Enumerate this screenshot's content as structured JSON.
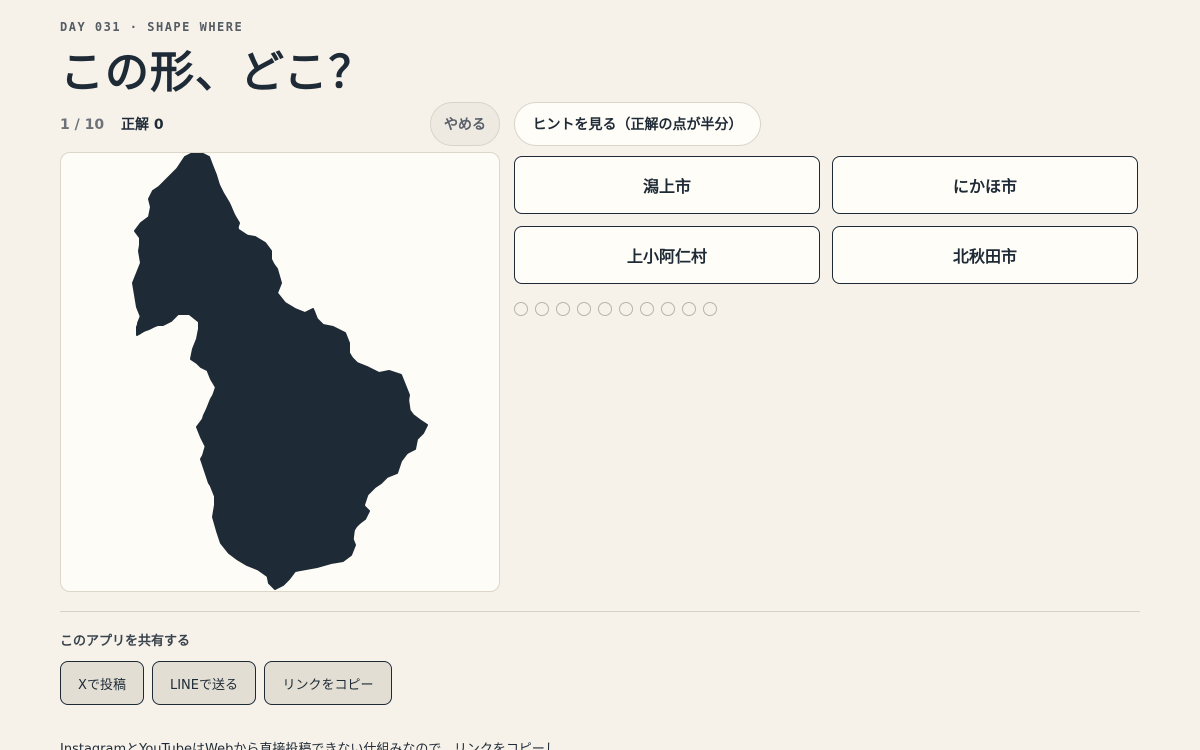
{
  "header": {
    "eyebrow": "DAY 031 · SHAPE WHERE",
    "title": "この形、どこ？"
  },
  "status": {
    "progress": "1 / 10",
    "score": "正解 0"
  },
  "controls": {
    "quit_label": "やめる",
    "hint_label": "ヒントを見る（正解の点が半分）"
  },
  "choices": [
    {
      "label": "潟上市"
    },
    {
      "label": "にかほ市"
    },
    {
      "label": "上小阿仁村"
    },
    {
      "label": "北秋田市"
    }
  ],
  "progress_dots": {
    "total": 10,
    "answered": 0
  },
  "shape": {
    "fill": "#1e2a36",
    "icon": "region-silhouette"
  },
  "share": {
    "label": "このアプリを共有する",
    "buttons": [
      {
        "label": "Xで投稿"
      },
      {
        "label": "LINEで送る"
      },
      {
        "label": "リンクをコピー"
      }
    ],
    "note": "InstagramとYouTubeはWebから直接投稿できない仕組みなので、リンクをコピーし"
  },
  "colors": {
    "background": "#f6f2ea",
    "ink": "#1e2a36",
    "card": "#fdfcf6"
  }
}
